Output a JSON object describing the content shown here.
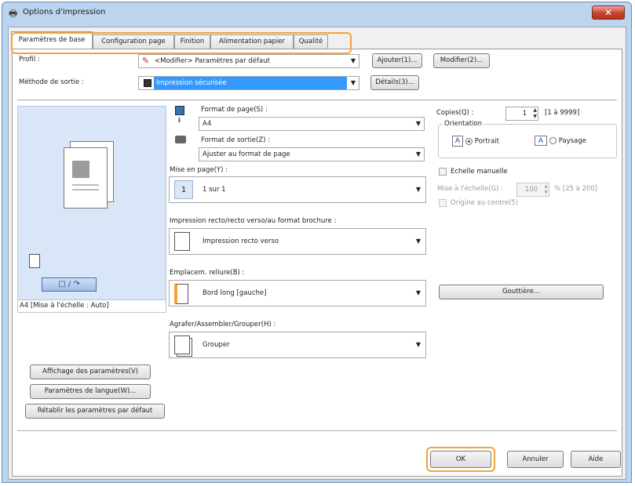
{
  "window": {
    "title": "Options d'impression",
    "close_glyph": "✕"
  },
  "tabs": [
    {
      "label": "Paramètres de base",
      "active": true
    },
    {
      "label": "Configuration page"
    },
    {
      "label": "Finition"
    },
    {
      "label": "Alimentation papier"
    },
    {
      "label": "Qualité"
    }
  ],
  "profile": {
    "label": "Profil :",
    "value": "<Modifier> Paramètres par défaut",
    "add_button": "Ajouter(1)...",
    "modify_button": "Modifier(2)..."
  },
  "output_method": {
    "label": "Méthode de sortie :",
    "value": "Impression sécurisée",
    "details_button": "Détails(3)..."
  },
  "preview": {
    "layout_toggle": "□ / ↷",
    "caption": "A4 [Mise à l'échelle : Auto]"
  },
  "left_buttons": {
    "view_settings": "Affichage des paramètres(V)",
    "language_settings": "Paramètres de langue(W)...",
    "restore_defaults": "Rétablir les paramètres par défaut"
  },
  "page_size": {
    "label": "Format de page(S) :",
    "value": "A4"
  },
  "output_size": {
    "label": "Format de sortie(Z) :",
    "value": "Ajuster au format de page"
  },
  "layout": {
    "label": "Mise en page(Y) :",
    "value": "1 sur 1",
    "icon_text": "1"
  },
  "duplex": {
    "label": "Impression recto/recto verso/au format brochure :",
    "value": "Impression recto verso"
  },
  "binding": {
    "label": "Emplacem. reliure(B) :",
    "value": "Bord long [gauche]"
  },
  "staple": {
    "label": "Agrafer/Assembler/Grouper(H) :",
    "value": "Grouper"
  },
  "copies": {
    "label": "Copies(Q) :",
    "value": "1",
    "range": "[1 à 9999]"
  },
  "orientation": {
    "group_label": "Orientation",
    "portrait": "Portrait",
    "landscape": "Paysage",
    "icon_letter": "A",
    "selected": "portrait"
  },
  "manual_scale": {
    "label": "Echelle manuelle",
    "scale_label": "Mise à l'échelle(G) :",
    "scale_value": "100",
    "scale_range": "% [25 à 200]",
    "origin_center": "Origine au centre(5)"
  },
  "gutter_button": "Gouttière...",
  "footer": {
    "ok": "OK",
    "cancel": "Annuler",
    "help": "Aide"
  },
  "colors": {
    "accent_highlight": "#f2a33a",
    "selection": "#3399ff",
    "close": "#c7432f"
  }
}
